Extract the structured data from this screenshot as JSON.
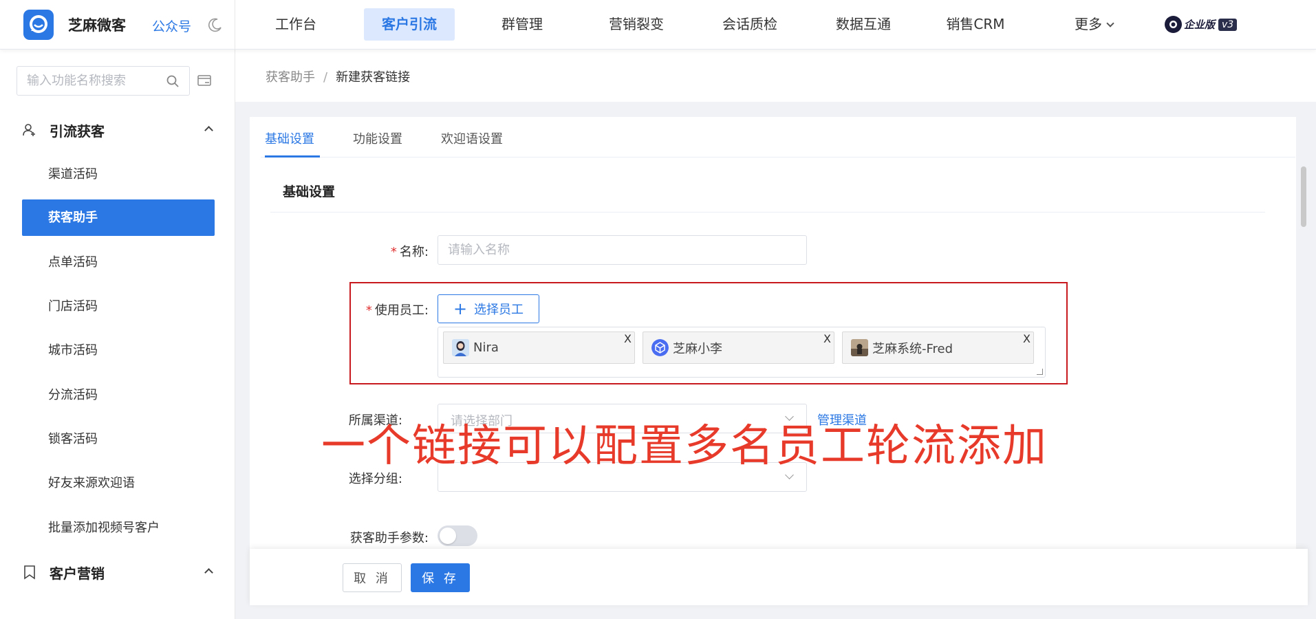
{
  "header": {
    "brand": "芝麻微客",
    "public_account": "公众号",
    "nav": [
      "工作台",
      "客户引流",
      "群管理",
      "营销裂变",
      "会话质检",
      "数据互通",
      "销售CRM",
      "更多"
    ],
    "edition": "企业版",
    "version": "v3"
  },
  "sidebar": {
    "search_placeholder": "输入功能名称搜索",
    "group1": "引流获客",
    "items": [
      "渠道活码",
      "获客助手",
      "点单活码",
      "门店活码",
      "城市活码",
      "分流活码",
      "锁客活码",
      "好友来源欢迎语",
      "批量添加视频号客户"
    ],
    "active_item": "获客助手",
    "group2": "客户营销"
  },
  "breadcrumb": {
    "parent": "获客助手",
    "separator": "/",
    "current": "新建获客链接"
  },
  "tabs": [
    "基础设置",
    "功能设置",
    "欢迎语设置"
  ],
  "section_title": "基础设置",
  "form": {
    "name_label": "名称:",
    "name_placeholder": "请输入名称",
    "staff_label": "使用员工:",
    "pick_staff": "选择员工",
    "staff": [
      {
        "name": "Nira",
        "close": "X"
      },
      {
        "name": "芝麻小李",
        "close": "X"
      },
      {
        "name": "芝麻系统-Fred",
        "close": "X"
      }
    ],
    "channel_label": "所属渠道:",
    "channel_placeholder": "请选择部门",
    "manage_channel": "管理渠道",
    "group_label": "选择分组:",
    "param_label": "获客助手参数:",
    "param_enabled": false
  },
  "overlay_text": "一个链接可以配置多名员工轮流添加",
  "footer": {
    "cancel": "取 消",
    "save": "保 存"
  },
  "colors": {
    "primary": "#2b78e4",
    "annotation": "#e83a2a",
    "frame": "#c8191e"
  }
}
